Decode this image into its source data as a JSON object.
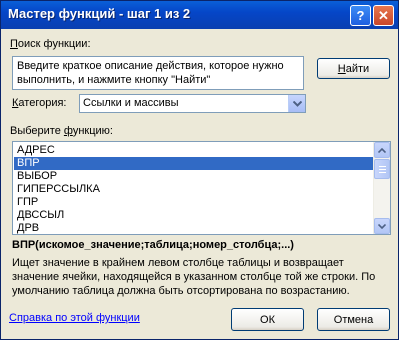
{
  "window": {
    "title": "Мастер функций - шаг 1 из 2",
    "help_button": "?",
    "close_button": "✕"
  },
  "search": {
    "label_ul": "П",
    "label_rest": "оиск функции:",
    "value": "Введите краткое описание действия, которое нужно выполнить, и нажмите кнопку \"Найти\"",
    "find_button_ul": "Н",
    "find_button_rest": "айти"
  },
  "category": {
    "label_ul": "К",
    "label_rest": "атегория:",
    "selected": "Ссылки и массивы"
  },
  "functions": {
    "label_pre": "Выберите ",
    "label_ul": "ф",
    "label_rest": "ункцию:",
    "items": [
      "АДРЕС",
      "ВПР",
      "ВЫБОР",
      "ГИПЕРССЫЛКА",
      "ГПР",
      "ДВССЫЛ",
      "ДРВ"
    ],
    "selected_index": 1
  },
  "details": {
    "syntax": "ВПР(искомое_значение;таблица;номер_столбца;...)",
    "description": "Ищет значение в крайнем левом столбце таблицы и возвращает значение ячейки, находящейся в указанном столбце той же строки. По умолчанию таблица должна быть отсортирована по возрастанию."
  },
  "footer": {
    "help_link": "Справка по этой функции",
    "ok_button": "ОК",
    "cancel_button": "Отмена"
  },
  "icons": {
    "help": "help-icon",
    "close": "close-icon",
    "dropdown": "chevron-down-icon",
    "scroll_up": "arrow-up-icon",
    "scroll_down": "arrow-down-icon"
  },
  "colors": {
    "titlebar": "#0a5fd8",
    "selection": "#316ac5",
    "link": "#0000ff",
    "dialog_bg": "#ece9d8"
  }
}
